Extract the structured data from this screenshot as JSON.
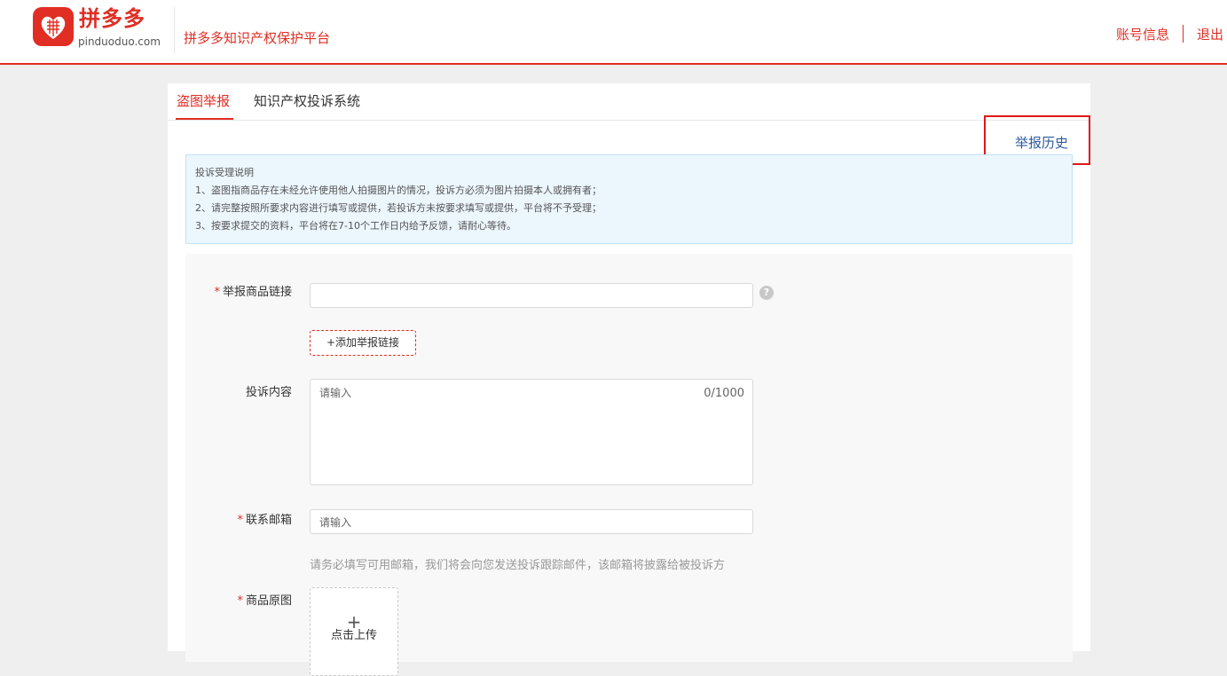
{
  "header": {
    "logo_text": "拼多多",
    "logo_domain": "pinduoduo.com",
    "platform_name": "拼多多知识产权保护平台",
    "account_info": "账号信息",
    "logout": "退出",
    "logo_icon": "pinduoduo-logo-icon"
  },
  "tabs": [
    {
      "label": "盗图举报",
      "active": true
    },
    {
      "label": "知识产权投诉系统",
      "active": false
    }
  ],
  "report_history": "举报历史",
  "notice": {
    "title": "投诉受理说明",
    "items": [
      "1、盗图指商品存在未经允许使用他人拍摄图片的情况，投诉方必须为图片拍摄本人或拥有者；",
      "2、请完整按照所要求内容进行填写或提供，若投诉方未按要求填写或提供，平台将不予受理；",
      "3、按要求提交的资料，平台将在7-10个工作日内给予反馈，请耐心等待。"
    ]
  },
  "form": {
    "required_mark": "*",
    "product_link": {
      "label": "举报商品链接",
      "value": "",
      "help_icon": "question-icon"
    },
    "add_link_button": "+添加举报链接",
    "complaint": {
      "label": "投诉内容",
      "placeholder": "请输入",
      "counter": "0/1000"
    },
    "email": {
      "label": "联系邮箱",
      "placeholder": "请输入",
      "hint": "请务必填写可用邮箱，我们将会向您发送投诉跟踪邮件，该邮箱将披露给被投诉方"
    },
    "original_image": {
      "label": "商品原图",
      "upload_plus": "+",
      "upload_label": "点击上传"
    }
  },
  "colors": {
    "brand": "#e02e24",
    "link": "#2e5a9c",
    "notice_bg": "#ecf6fd",
    "highlight_box": "#e01818"
  }
}
